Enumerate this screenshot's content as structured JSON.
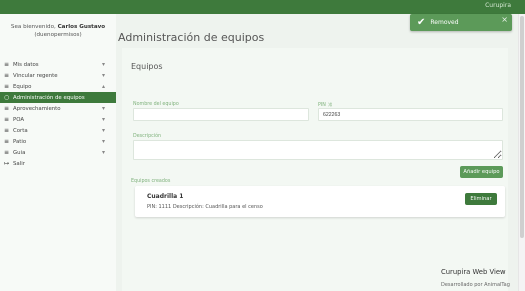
{
  "topbar": {
    "app_name": "Curupira"
  },
  "toast": {
    "icon": "check-icon",
    "message": "Removed",
    "close": "×"
  },
  "sidebar": {
    "welcome_prefix": "Sea bienvenido,",
    "user_name": "Carlos Gustavo",
    "user_handle": "(duenopermisos)",
    "items": [
      {
        "label": "Mis datos",
        "icon": "menu-icon",
        "chevron": "▾"
      },
      {
        "label": "Vincular regente",
        "icon": "menu-icon",
        "chevron": "▾"
      },
      {
        "label": "Equipo",
        "icon": "menu-icon",
        "chevron": "▴"
      },
      {
        "label": "Administración de equipos",
        "icon": "circle-icon",
        "chevron": ""
      },
      {
        "label": "Aprovechamiento",
        "icon": "menu-icon",
        "chevron": "▾"
      },
      {
        "label": "POA",
        "icon": "menu-icon",
        "chevron": "▾"
      },
      {
        "label": "Corta",
        "icon": "menu-icon",
        "chevron": "▾"
      },
      {
        "label": "Patio",
        "icon": "menu-icon",
        "chevron": "▾"
      },
      {
        "label": "Guia",
        "icon": "menu-icon",
        "chevron": "▾"
      },
      {
        "label": "Salir",
        "icon": "logout-icon",
        "chevron": ""
      }
    ]
  },
  "main": {
    "page_title": "Administración de equipos",
    "section_title": "Equipos",
    "form": {
      "name_label": "Nombre del equipo",
      "name_value": "",
      "pin_label": "PIN",
      "pin_value": "622263",
      "description_label": "Descripción",
      "description_value": "",
      "add_button": "Añadir equipo"
    },
    "created_label": "Equipos creados",
    "teams": [
      {
        "name": "Cuadrilla 1",
        "meta": "PIN: 1111  Descripción: Cuadrilla para el censo",
        "delete_button": "Eliminar"
      }
    ]
  },
  "footer": {
    "brand": "Curupira Web View",
    "credit": "Desarrollado por AnimalTag"
  },
  "colors": {
    "primary": "#3e7a3c",
    "accent": "#5c9a59",
    "label": "#7fb17c",
    "background": "#eef3ee"
  }
}
